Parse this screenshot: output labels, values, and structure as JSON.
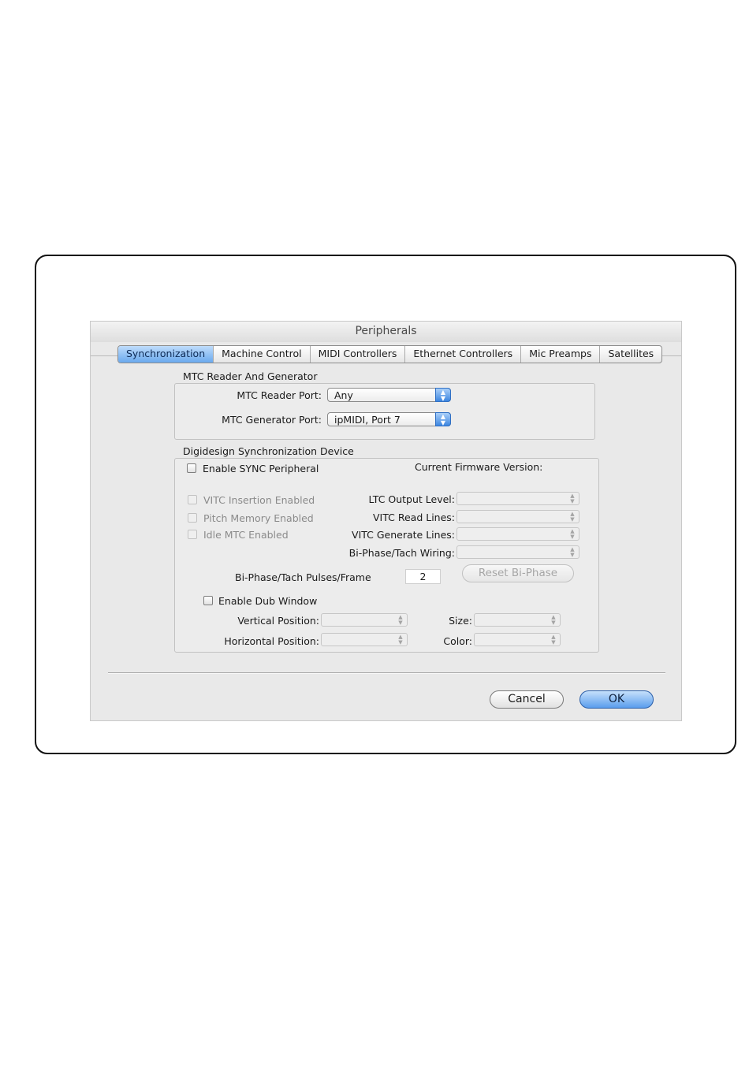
{
  "window": {
    "title": "Peripherals"
  },
  "tabs": [
    {
      "label": "Synchronization",
      "active": true
    },
    {
      "label": "Machine Control",
      "active": false
    },
    {
      "label": "MIDI Controllers",
      "active": false
    },
    {
      "label": "Ethernet Controllers",
      "active": false
    },
    {
      "label": "Mic Preamps",
      "active": false
    },
    {
      "label": "Satellites",
      "active": false
    }
  ],
  "mtc": {
    "heading": "MTC Reader And Generator",
    "reader_label": "MTC Reader Port:",
    "reader_value": "Any",
    "generator_label": "MTC Generator Port:",
    "generator_value": "ipMIDI, Port 7"
  },
  "sync": {
    "heading": "Digidesign Synchronization Device",
    "enable_label": "Enable SYNC Peripheral",
    "firmware_label": "Current Firmware Version:",
    "vitc_insertion_label": "VITC Insertion Enabled",
    "pitch_memory_label": "Pitch Memory Enabled",
    "idle_mtc_label": "Idle MTC Enabled",
    "ltc_output_label": "LTC Output Level:",
    "vitc_read_label": "VITC Read Lines:",
    "vitc_generate_label": "VITC Generate Lines:",
    "biphase_wiring_label": "Bi-Phase/Tach Wiring:",
    "pulses_label": "Bi-Phase/Tach Pulses/Frame",
    "pulses_value": "2",
    "reset_label": "Reset Bi-Phase",
    "dub_label": "Enable Dub Window",
    "vertical_label": "Vertical Position:",
    "horizontal_label": "Horizontal Position:",
    "size_label": "Size:",
    "color_label": "Color:"
  },
  "buttons": {
    "cancel": "Cancel",
    "ok": "OK"
  },
  "icons": {
    "popup_arrows": "up-down-arrows-icon"
  },
  "colors": {
    "accent": "#5a9ded"
  }
}
